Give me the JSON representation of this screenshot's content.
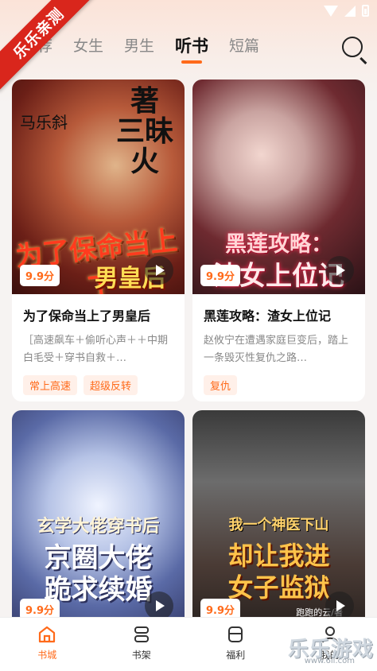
{
  "app": {
    "ribbon_label": "乐乐亲测",
    "watermark": "乐乐游戏",
    "watermark_url": "www.6ll.com"
  },
  "tabs": [
    {
      "label": "推荐",
      "active": false
    },
    {
      "label": "女生",
      "active": false
    },
    {
      "label": "男生",
      "active": false
    },
    {
      "label": "听书",
      "active": true
    },
    {
      "label": "短篇",
      "active": false
    }
  ],
  "colors": {
    "accent": "#ff6a1a",
    "ribbon": "#d9261c"
  },
  "books": [
    {
      "score": "9.9分",
      "cover_author": "马乐斜",
      "cover_badge": "著 三昧火",
      "cover_title_line1": "为了保命当上了",
      "cover_title_line2": "男皇后",
      "title": "为了保命当上了男皇后",
      "desc": "［高速飙车＋偷听心声＋＋中期白毛受＋穿书自救＋…",
      "tags": [
        "常上高速",
        "超级反转"
      ]
    },
    {
      "score": "9.9分",
      "cover_title_line1": "黑莲攻略：",
      "cover_title_line2": "渣女上位记",
      "title": "黑莲攻略：渣女上位记",
      "desc": "赵攸宁在遭遇家庭巨变后，踏上一条毁灭性复仇之路…",
      "tags": [
        "复仇"
      ]
    },
    {
      "score": "9.9分",
      "cover_title_line1": "玄学大佬穿书后",
      "cover_title_line2": "京圈大佬",
      "cover_title_line3": "跪求续婚"
    },
    {
      "score": "9.9分",
      "cover_title_line1": "我一个神医下山",
      "cover_title_line2": "却让我进",
      "cover_title_line3": "女子监狱",
      "cover_author": "跑跑的云/著"
    }
  ],
  "bottom_nav": [
    {
      "label": "书城",
      "icon": "home-icon",
      "active": true
    },
    {
      "label": "书架",
      "icon": "bookshelf-icon",
      "active": false
    },
    {
      "label": "福利",
      "icon": "gift-icon",
      "active": false
    },
    {
      "label": "我的",
      "icon": "user-icon",
      "active": false
    }
  ]
}
